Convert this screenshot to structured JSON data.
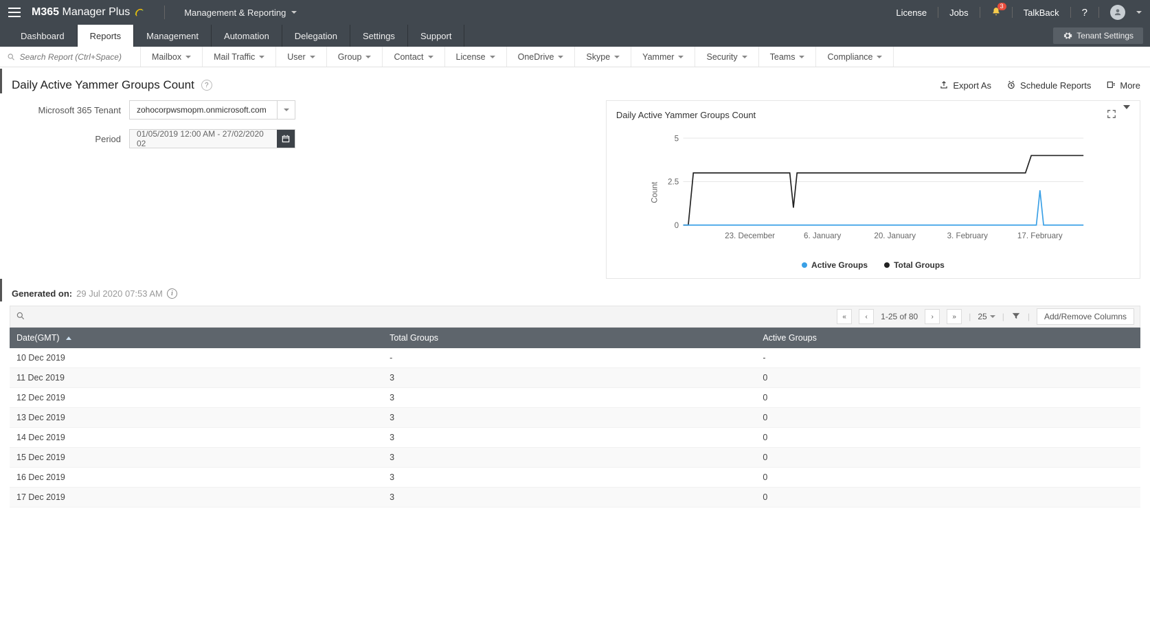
{
  "header": {
    "logo_m365": "M365",
    "logo_manager": "Manager",
    "logo_plus": "Plus",
    "section_label": "Management & Reporting",
    "links": {
      "license": "License",
      "jobs": "Jobs",
      "talkback": "TalkBack",
      "notification_count": "3"
    }
  },
  "main_tabs": {
    "items": [
      {
        "label": "Dashboard"
      },
      {
        "label": "Reports"
      },
      {
        "label": "Management"
      },
      {
        "label": "Automation"
      },
      {
        "label": "Delegation"
      },
      {
        "label": "Settings"
      },
      {
        "label": "Support"
      }
    ],
    "tenant_settings_label": "Tenant Settings"
  },
  "filter_bar": {
    "search_placeholder": "Search Report (Ctrl+Space)",
    "items": [
      {
        "label": "Mailbox"
      },
      {
        "label": "Mail Traffic"
      },
      {
        "label": "User"
      },
      {
        "label": "Group"
      },
      {
        "label": "Contact"
      },
      {
        "label": "License"
      },
      {
        "label": "OneDrive"
      },
      {
        "label": "Skype"
      },
      {
        "label": "Yammer"
      },
      {
        "label": "Security"
      },
      {
        "label": "Teams"
      },
      {
        "label": "Compliance"
      }
    ]
  },
  "page": {
    "title": "Daily Active Yammer Groups Count",
    "actions": {
      "export_as": "Export As",
      "schedule_reports": "Schedule Reports",
      "more": "More"
    }
  },
  "form": {
    "tenant_label": "Microsoft 365 Tenant",
    "tenant_value": "zohocorpwsmopm.onmicrosoft.com",
    "period_label": "Period",
    "period_value": "01/05/2019 12:00 AM - 27/02/2020 02"
  },
  "chart_data": {
    "type": "line",
    "title": "Daily Active Yammer Groups Count",
    "ylabel": "Count",
    "xlabel": "",
    "ylim": [
      0,
      5
    ],
    "x_ticks": [
      "23. December",
      "6. January",
      "20. January",
      "3. February",
      "17. February"
    ],
    "y_ticks": [
      0,
      2.5,
      5
    ],
    "series": [
      {
        "name": "Active Groups",
        "color": "#3aa0e6",
        "points": [
          {
            "x": "10 Dec 2019",
            "y": 0
          },
          {
            "x": "16 Feb 2020",
            "y": 0
          },
          {
            "x": "17 Feb 2020",
            "y": 2
          },
          {
            "x": "18 Feb 2020",
            "y": 0
          },
          {
            "x": "27 Feb 2020",
            "y": 0
          }
        ]
      },
      {
        "name": "Total Groups",
        "color": "#222222",
        "points": [
          {
            "x": "10 Dec 2019",
            "y": 0
          },
          {
            "x": "11 Dec 2019",
            "y": 3
          },
          {
            "x": "31 Dec 2019",
            "y": 3
          },
          {
            "x": "1 Jan 2020",
            "y": 1
          },
          {
            "x": "2 Jan 2020",
            "y": 3
          },
          {
            "x": "14 Feb 2020",
            "y": 3
          },
          {
            "x": "15 Feb 2020",
            "y": 4
          },
          {
            "x": "27 Feb 2020",
            "y": 4
          }
        ]
      }
    ],
    "legend": [
      "Active Groups",
      "Total Groups"
    ]
  },
  "generated": {
    "label": "Generated on:",
    "timestamp": "29 Jul 2020 07:53 AM"
  },
  "table_toolbar": {
    "page_range": "1-25 of 80",
    "page_size": "25",
    "add_remove_cols": "Add/Remove Columns"
  },
  "table": {
    "columns": [
      {
        "label": "Date(GMT)",
        "sort": "asc"
      },
      {
        "label": "Total Groups"
      },
      {
        "label": "Active Groups"
      }
    ],
    "rows": [
      {
        "date": "10 Dec 2019",
        "total": "-",
        "active": "-"
      },
      {
        "date": "11 Dec 2019",
        "total": "3",
        "active": "0"
      },
      {
        "date": "12 Dec 2019",
        "total": "3",
        "active": "0"
      },
      {
        "date": "13 Dec 2019",
        "total": "3",
        "active": "0"
      },
      {
        "date": "14 Dec 2019",
        "total": "3",
        "active": "0"
      },
      {
        "date": "15 Dec 2019",
        "total": "3",
        "active": "0"
      },
      {
        "date": "16 Dec 2019",
        "total": "3",
        "active": "0"
      },
      {
        "date": "17 Dec 2019",
        "total": "3",
        "active": "0"
      }
    ]
  }
}
